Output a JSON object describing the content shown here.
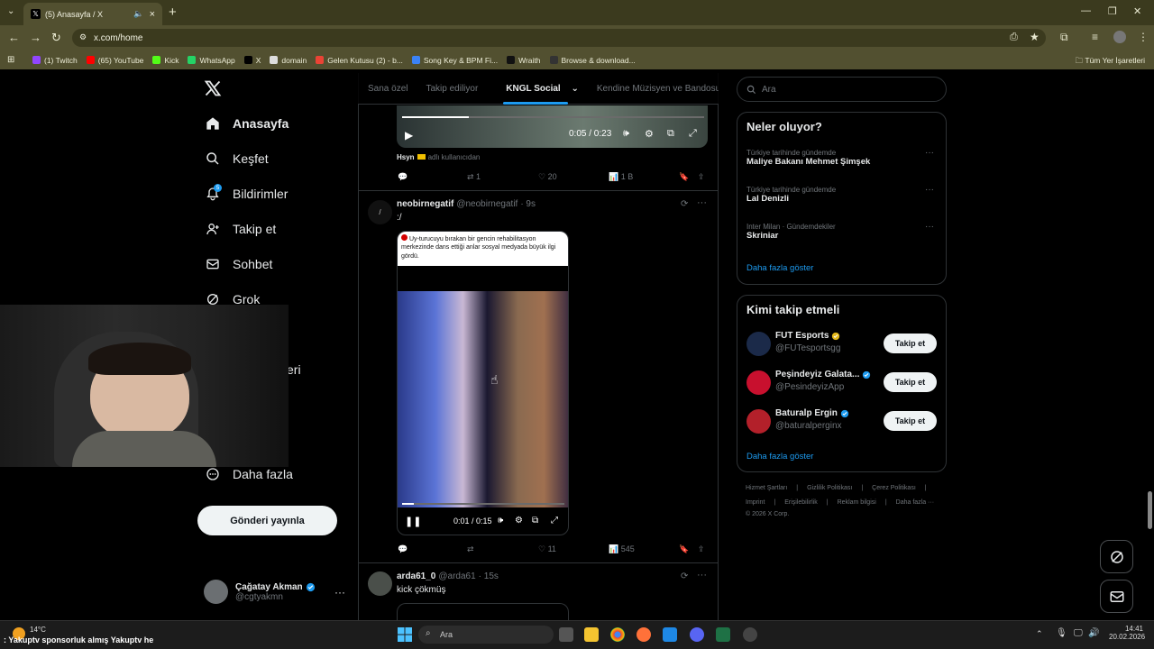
{
  "browser": {
    "tab_title": "(5) Anasayfa / X",
    "url": "x.com/home",
    "bookmarks": [
      {
        "label": "(1) Twitch",
        "color": "#9146ff"
      },
      {
        "label": "(65) YouTube",
        "color": "#ff0000"
      },
      {
        "label": "Kick",
        "color": "#53fc18"
      },
      {
        "label": "WhatsApp",
        "color": "#25d366"
      },
      {
        "label": "X",
        "color": "#000000"
      },
      {
        "label": "domain",
        "color": "#dddddd"
      },
      {
        "label": "Gelen Kutusu (2) - b...",
        "color": "#ea4335"
      },
      {
        "label": "Song Key & BPM Fi...",
        "color": "#3b82f6"
      },
      {
        "label": "Wraith",
        "color": "#111111"
      },
      {
        "label": "Browse & download...",
        "color": "#333333"
      }
    ],
    "all_bookmarks": "Tüm Yer İşaretleri"
  },
  "sidebar": {
    "items": [
      {
        "label": "Anasayfa",
        "icon": "home-icon"
      },
      {
        "label": "Keşfet",
        "icon": "search-icon"
      },
      {
        "label": "Bildirimler",
        "icon": "bell-icon",
        "badge": "5"
      },
      {
        "label": "Takip et",
        "icon": "add-user-icon"
      },
      {
        "label": "Sohbet",
        "icon": "mail-icon"
      },
      {
        "label": "Grok",
        "icon": "grok-icon"
      },
      {
        "label": "eri",
        "icon": ""
      },
      {
        "label": "Daha fazla",
        "icon": "more-circle-icon"
      }
    ],
    "post_button": "Gönderi yayınla",
    "user": {
      "name": "Çağatay Akman",
      "handle": "@cgtyakmn"
    }
  },
  "feed": {
    "tabs": [
      "Sana özel",
      "Takip ediliyor",
      "KNGL Social",
      "Kendine Müzisyen ve Bandosu"
    ],
    "active_tab": "KNGL Social",
    "post1": {
      "video_time": "0:05 / 0:23",
      "video_progress": 0.22,
      "source": "Hsyn",
      "source_suffix": "adlı kullanıcıdan",
      "retweets": "1",
      "likes": "20",
      "views": "1 B"
    },
    "post2": {
      "name": "neobirnegatif",
      "handle": "@neobirnegatif",
      "time": "· 9s",
      "text": ":/",
      "banner": "Uy-turucuyu bırakan bir gencin rehabilitasyon merkezinde dans ettiği anlar sosyal medyada büyük ilgi gördü.",
      "video_time": "0:01 / 0:15",
      "video_progress": 0.07,
      "likes": "11",
      "views": "545"
    },
    "post3": {
      "name": "arda61_0",
      "handle": "@arda61",
      "time": "· 15s",
      "text": "kick çökmüş"
    }
  },
  "right": {
    "search_placeholder": "Ara",
    "trends_title": "Neler oluyor?",
    "trends": [
      {
        "meta": "Türkiye tarihinde gündemde",
        "name": "Maliye Bakanı Mehmet Şimşek"
      },
      {
        "meta": "Türkiye tarihinde gündemde",
        "name": "Lal Denizli"
      },
      {
        "meta": "Inter Milan · Gündemdekiler",
        "name": "Skriniar"
      }
    ],
    "show_more": "Daha fazla göster",
    "who_title": "Kimi takip etmeli",
    "who": [
      {
        "name": "FUT Esports",
        "handle": "@FUTesportsgg",
        "badge": "gold",
        "avatar_color": "#1b2a49"
      },
      {
        "name": "Peşindeyiz Galata...",
        "handle": "@PesindeyizApp",
        "badge": "blue",
        "avatar_color": "#c8102e"
      },
      {
        "name": "Baturalp Ergin",
        "handle": "@baturalperginx",
        "badge": "blue",
        "avatar_color": "#b3202a"
      }
    ],
    "follow_label": "Takip et",
    "footer_row1": [
      "Hizmet Şartları",
      "Gizlilik Politikası",
      "Çerez Politikası"
    ],
    "footer_row2": [
      "Imprint",
      "Erişilebilirlik",
      "Reklam bilgisi",
      "Daha fazla ···"
    ],
    "copyright": "© 2026 X Corp."
  },
  "taskbar": {
    "weather": "14°C",
    "ticker": ": Yakuptv sponsorluk almış Yakuptv he",
    "search": "Ara",
    "time": "14:41",
    "date": "20.02.2026"
  },
  "colors": {
    "accent": "#1d9bf0",
    "browser": "#525030"
  }
}
